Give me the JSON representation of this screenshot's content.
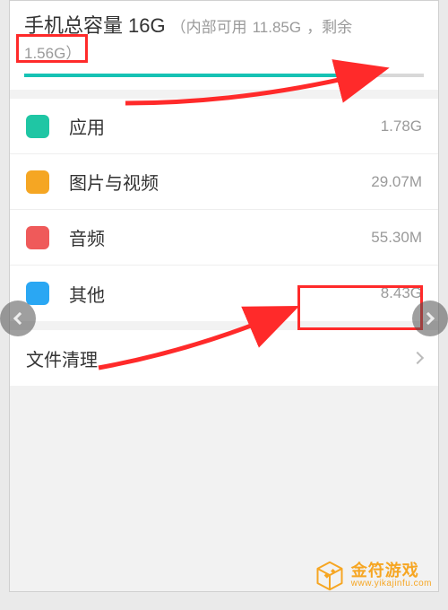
{
  "header": {
    "title_prefix": "手机总容量",
    "total_capacity": "16G",
    "subtitle_open": "（内部可用",
    "internal_available": "11.85G",
    "subtitle_sep": "，剩余",
    "remaining": "1.56G",
    "subtitle_close": "）",
    "progress_percent": 83
  },
  "categories": [
    {
      "label": "应用",
      "value": "1.78G",
      "color": "#1fc6a4"
    },
    {
      "label": "图片与视频",
      "value": "29.07M",
      "color": "#f5a623"
    },
    {
      "label": "音频",
      "value": "55.30M",
      "color": "#ef5a5a"
    },
    {
      "label": "其他",
      "value": "8.43G",
      "color": "#2aa7f3"
    }
  ],
  "cleanup": {
    "label": "文件清理"
  },
  "nav": {
    "prev_icon": "chevron-left",
    "next_icon": "chevron-right"
  },
  "watermark": {
    "brand": "金符游戏",
    "url_text": "www.yikajinfu.com",
    "brand_color": "#f6a623"
  },
  "annotations": {
    "highlight_remaining": true,
    "highlight_other_value": true
  }
}
